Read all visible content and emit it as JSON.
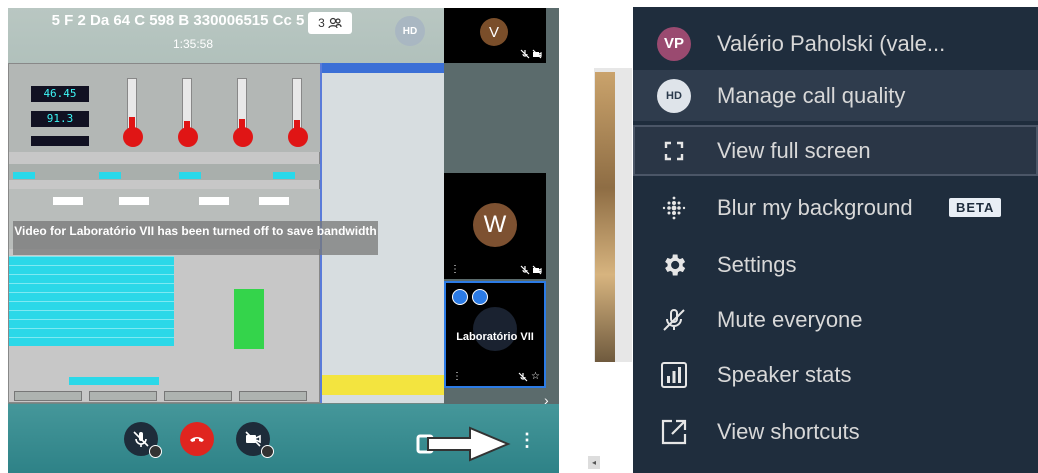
{
  "meeting": {
    "title": "5 F 2 Da 64 C 598 B 330006515 Cc 5",
    "timer": "1:35:58",
    "participant_count": "3",
    "self_avatar": "HD",
    "bandwidth_message": "Video for Laboratório VII has been turned off to save bandwidth",
    "lcd_values": [
      "46.45",
      "91.3"
    ],
    "tiles": [
      {
        "initial": "V"
      },
      {
        "initial": "W"
      },
      {
        "name": "Laboratório VII"
      }
    ]
  },
  "menu": {
    "items": [
      {
        "label": "Valério Paholski (vale...",
        "avatar": "VP",
        "icon": "avatar"
      },
      {
        "label": "Manage call quality",
        "avatar": "HD",
        "icon": "hd-avatar"
      },
      {
        "label": "View full screen",
        "icon": "fullscreen-icon"
      },
      {
        "label": "Blur my background",
        "badge": "BETA",
        "icon": "blur-icon"
      },
      {
        "label": "Settings",
        "icon": "gear-icon"
      },
      {
        "label": "Mute everyone",
        "icon": "mute-everyone-icon"
      },
      {
        "label": "Speaker stats",
        "icon": "stats-icon"
      },
      {
        "label": "View shortcuts",
        "icon": "shortcut-icon"
      }
    ]
  },
  "colors": {
    "menu_bg": "#1f2d3d",
    "toolbar": "#3b8f93",
    "hangup": "#e0251f",
    "accent_blue": "#2c7be5"
  }
}
